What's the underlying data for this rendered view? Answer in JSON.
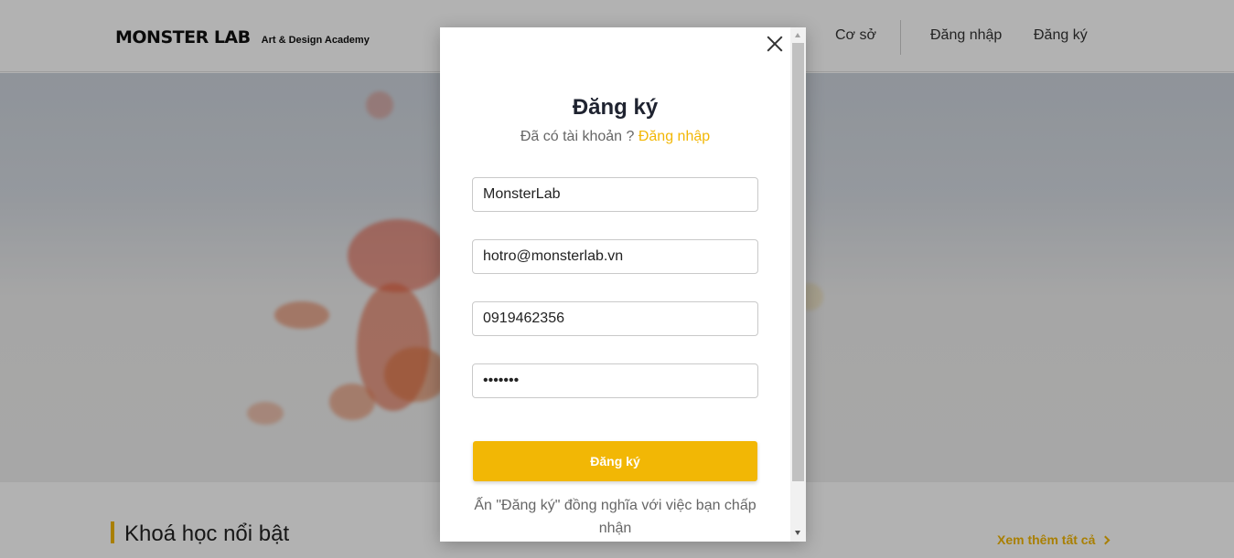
{
  "header": {
    "logo_main": "MONSTER LAB",
    "logo_sub": "Art & Design Academy",
    "nav": {
      "campus": "Cơ sở",
      "login": "Đăng nhập",
      "register": "Đăng ký"
    }
  },
  "section": {
    "title": "Khoá học nổi bật",
    "see_all": "Xem thêm tất cả"
  },
  "modal": {
    "title": "Đăng ký",
    "subtitle_prefix": "Đã có tài khoản ?",
    "login_link": "Đăng nhập",
    "fields": {
      "name": "MonsterLab",
      "email": "hotro@monsterlab.vn",
      "phone": "0919462356",
      "password": "•••••••"
    },
    "submit_label": "Đăng ký",
    "terms_text": "Ấn \"Đăng ký\" đồng nghĩa với việc bạn chấp nhận"
  },
  "colors": {
    "accent": "#f2b705",
    "overlay": "rgba(0,0,0,0.30)"
  },
  "icons": {
    "close": "close-icon",
    "chevron": "chevron-right-icon"
  }
}
